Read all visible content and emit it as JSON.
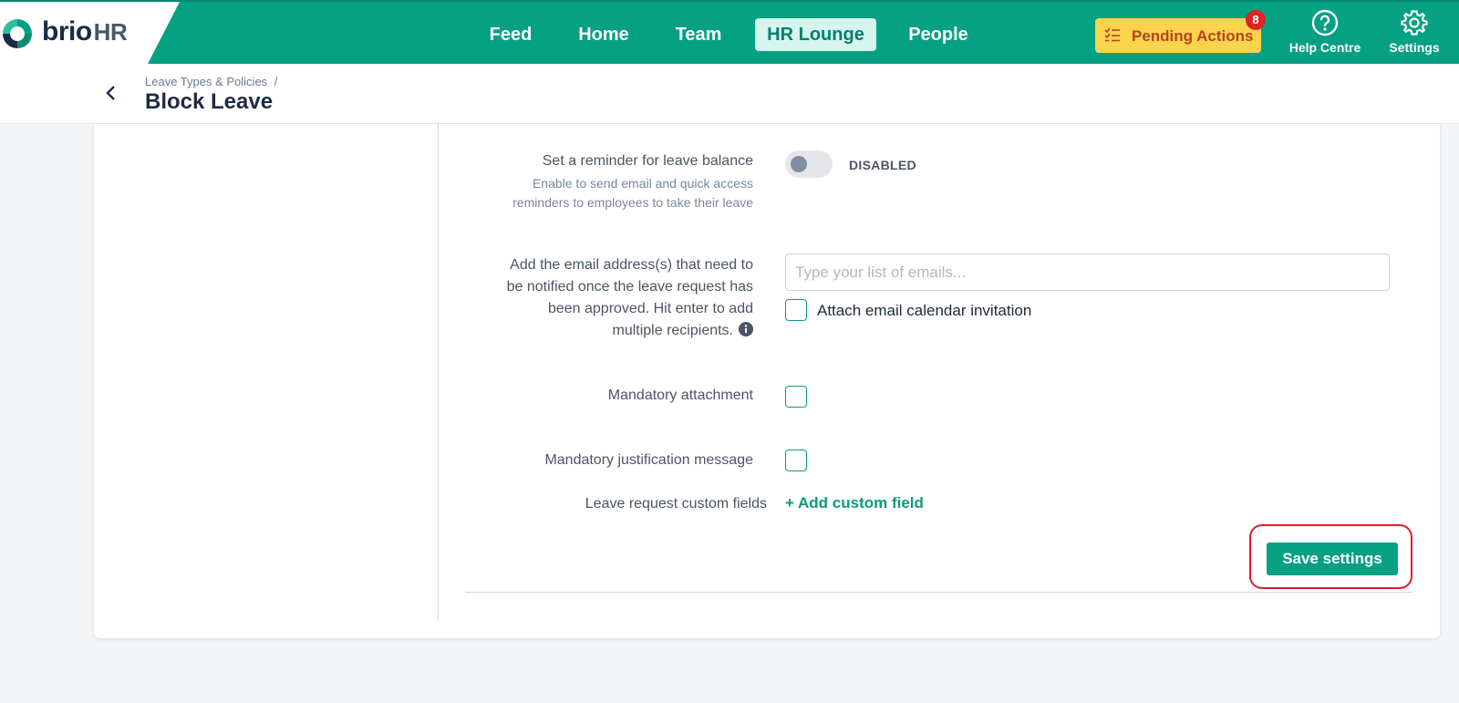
{
  "brand": {
    "name": "brio",
    "suffix": "HR"
  },
  "nav": {
    "items": [
      {
        "label": "Feed",
        "active": false
      },
      {
        "label": "Home",
        "active": false
      },
      {
        "label": "Team",
        "active": false
      },
      {
        "label": "HR Lounge",
        "active": true
      },
      {
        "label": "People",
        "active": false
      }
    ]
  },
  "pending": {
    "label": "Pending Actions",
    "count": "8"
  },
  "help": {
    "label": "Help Centre"
  },
  "settings": {
    "label": "Settings"
  },
  "breadcrumb": {
    "parent": "Leave Types & Policies",
    "separator": "/"
  },
  "page": {
    "title": "Block Leave"
  },
  "reminder": {
    "label": "Set a reminder for leave balance",
    "description_line1": "Enable to send email and quick access",
    "description_line2": "reminders to employees to take their leave",
    "state": "DISABLED"
  },
  "notify": {
    "label_line1": "Add the email address(s) that need to",
    "label_line2": "be notified once the leave request has",
    "label_line3": "been approved. Hit enter to add",
    "label_line4": "multiple recipients.",
    "placeholder": "Type your list of emails...",
    "attach_label": "Attach email calendar invitation"
  },
  "mandatory_attachment": {
    "label": "Mandatory attachment"
  },
  "mandatory_justification": {
    "label": "Mandatory justification message"
  },
  "custom_fields": {
    "label": "Leave request custom fields",
    "action": "+ Add custom field"
  },
  "save": {
    "label": "Save settings"
  },
  "colors": {
    "brand": "#06a083",
    "pending": "#fcd34d",
    "badge": "#dc2626",
    "highlight": "#e11d2a"
  }
}
